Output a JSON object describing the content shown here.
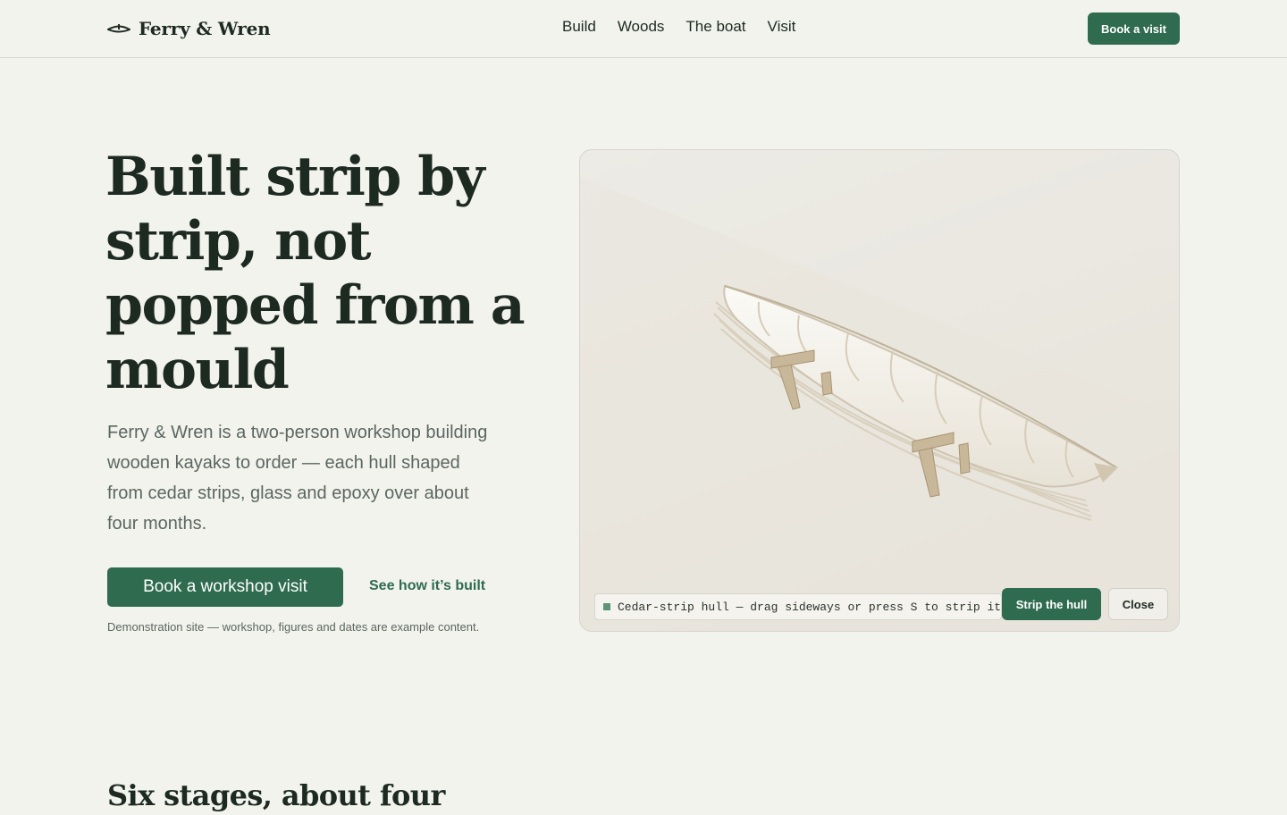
{
  "header": {
    "brand": "Ferry & Wren",
    "brand_icon": "kayak-icon",
    "nav": [
      "Build",
      "Woods",
      "The boat",
      "Visit"
    ],
    "cta_label": "Book a visit"
  },
  "hero": {
    "title": "Built strip by strip, not popped from a mould",
    "lead": "Ferry & Wren is a two-person workshop building wooden kayaks to order — each hull shaped from cedar strips, glass and epoxy over about four months.",
    "primary_cta": "Book a workshop visit",
    "secondary_link": "See how it’s built",
    "disclaimer": "Demonstration site — workshop, figures and dates are example content."
  },
  "viewer": {
    "caption": "Cedar-strip hull — drag sideways or press S to strip it",
    "strip_button": "Strip the hull",
    "close_button": "Close"
  },
  "next_section": {
    "heading": "Six stages, about four"
  },
  "colors": {
    "background": "#f3f3ee",
    "accent": "#2f6b4f",
    "text": "#1d2a22",
    "muted": "#5c6660"
  }
}
